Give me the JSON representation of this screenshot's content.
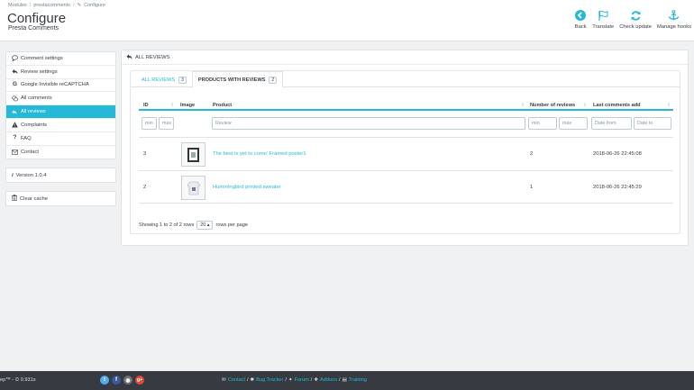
{
  "breadcrumb": [
    "Modules",
    "prestacomments",
    "Configure"
  ],
  "header": {
    "title": "Configure",
    "subtitle": "Presta Comments"
  },
  "toolbar": [
    {
      "label": "Back",
      "icon": "back-icon"
    },
    {
      "label": "Translate",
      "icon": "flag-icon"
    },
    {
      "label": "Check update",
      "icon": "refresh-icon"
    },
    {
      "label": "Manage hooks",
      "icon": "anchor-icon"
    }
  ],
  "sidebar": {
    "items": [
      {
        "label": "Comment settings",
        "icon": "comment-icon"
      },
      {
        "label": "Review settings",
        "icon": "reply-icon"
      },
      {
        "label": "Google Invisible reCAPTCHA",
        "icon": "google-icon"
      },
      {
        "label": "All comments",
        "icon": "comments-icon"
      },
      {
        "label": "All reviews",
        "icon": "reviews-icon",
        "active": true
      },
      {
        "label": "Complaints",
        "icon": "warning-icon"
      },
      {
        "label": "FAQ",
        "icon": "question-icon"
      },
      {
        "label": "Contact",
        "icon": "envelope-icon"
      }
    ],
    "version": "Version 1.0.4",
    "clear_cache": "Clear cache"
  },
  "panel": {
    "title": "ALL REVIEWS",
    "tabs": [
      {
        "label": "ALL REVIEWS",
        "count": "3"
      },
      {
        "label": "PRODUCTS WITH REVIEWS",
        "count": "2"
      }
    ],
    "table": {
      "headers": {
        "id": "ID",
        "image": "Image",
        "product": "Product",
        "num": "Number of reviews",
        "last": "Last comments add"
      },
      "filters": {
        "min": "min",
        "max": "max",
        "review": "Review",
        "date_from": "Date from",
        "date_to": "Date to"
      },
      "rows": [
        {
          "id": "3",
          "product": "The best is yet to come' Framed poster1",
          "num": "2",
          "last": "2018-06-26 22:45:08"
        },
        {
          "id": "2",
          "product": "Hummingbird printed sweater",
          "num": "1",
          "last": "2018-06-26 22:45:29"
        }
      ],
      "showing": "Showing 1 to 2 of 2 rows",
      "per_page_value": "20",
      "per_page_text": "rows per page"
    }
  },
  "footer": {
    "version": "ep™ - ⏲ 0.931s",
    "socials": [
      "twitter-icon",
      "facebook-icon",
      "github-icon",
      "google-plus-icon"
    ],
    "links": [
      "Contact",
      "Bug Tracker",
      "Forum",
      "Addons",
      "Training"
    ]
  },
  "colors": {
    "accent": "#25b9d7",
    "footer": "#363a41",
    "twitter": "#50abf1",
    "facebook": "#3b5998",
    "github": "#6e7273",
    "gplus": "#dd4b39"
  }
}
